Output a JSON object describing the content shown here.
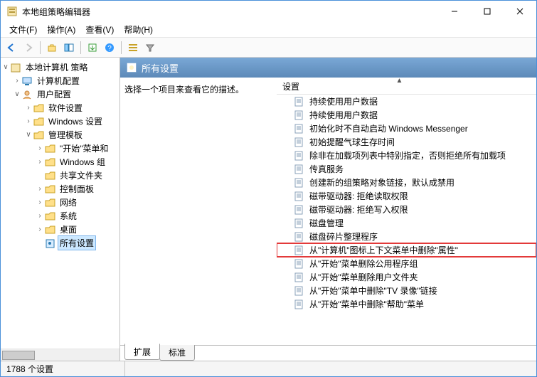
{
  "window": {
    "title": "本地组策略编辑器"
  },
  "menu": {
    "file": "文件(F)",
    "action": "操作(A)",
    "view": "查看(V)",
    "help": "帮助(H)"
  },
  "tree": {
    "root": "本地计算机 策略",
    "computer_config": "计算机配置",
    "user_config": "用户配置",
    "software_settings": "软件设置",
    "windows_settings": "Windows 设置",
    "admin_templates": "管理模板",
    "start_menu_and": "\"开始\"菜单和",
    "windows_components": "Windows 组",
    "shared_folders": "共享文件夹",
    "control_panel": "控制面板",
    "network": "网络",
    "system": "系统",
    "desktop": "桌面",
    "all_settings": "所有设置"
  },
  "detail": {
    "header": "所有设置",
    "desc": "选择一个项目来查看它的描述。",
    "col_settings": "设置",
    "items": [
      "持续使用用户数据",
      "持续使用用户数据",
      "初始化时不自动启动 Windows Messenger",
      "初始提醒气球生存时间",
      "除非在加载项列表中特别指定，否则拒绝所有加载项",
      "传真服务",
      "创建新的组策略对象链接，默认成禁用",
      "磁带驱动器: 拒绝读取权限",
      "磁带驱动器: 拒绝写入权限",
      "磁盘管理",
      "磁盘碎片整理程序",
      "从\"计算机\"图标上下文菜单中删除\"属性\"",
      "从\"开始\"菜单删除公用程序组",
      "从\"开始\"菜单删除用户文件夹",
      "从\"开始\"菜单中删除\"TV 录像\"链接",
      "从\"开始\"菜单中删除\"帮助\"菜单"
    ],
    "highlight_index": 11
  },
  "tabs": {
    "extended": "扩展",
    "standard": "标准"
  },
  "status": {
    "count": "1788 个设置"
  }
}
